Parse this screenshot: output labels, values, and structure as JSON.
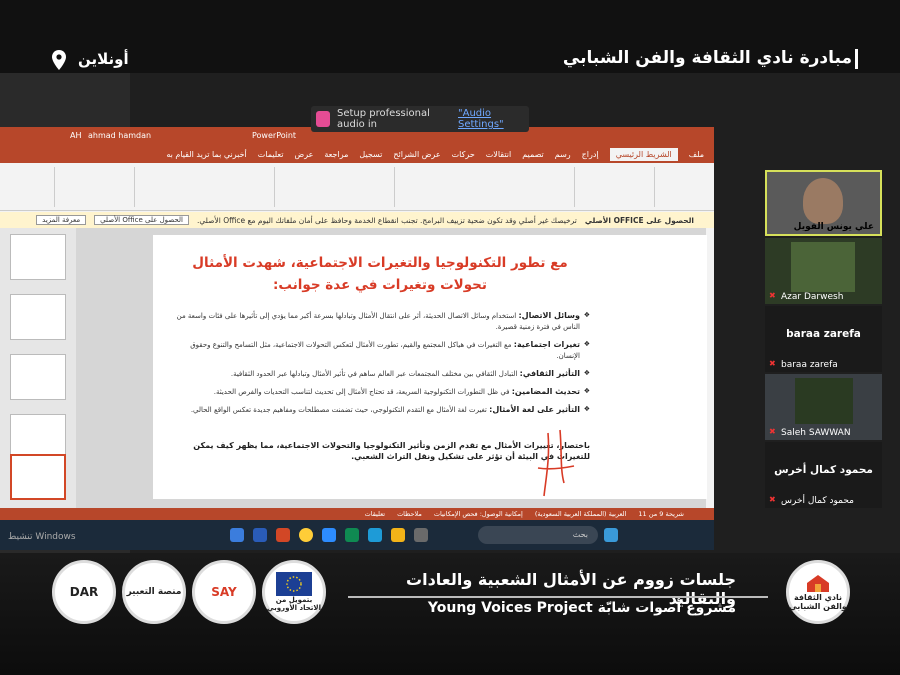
{
  "banner": {
    "title": "مبادرة نادي الثقافة والفن الشبابي",
    "location": "أونلاين"
  },
  "zoom": {
    "audio_prompt": "Setup professional audio in",
    "audio_link": "\"Audio Settings\""
  },
  "powerpoint": {
    "user": "ahmad hamdan",
    "app": "PowerPoint",
    "tabs": [
      "ملف",
      "الشريط الرئيسي",
      "إدراج",
      "رسم",
      "تصميم",
      "انتقالات",
      "حركات",
      "عرض الشرائح",
      "تسجيل",
      "مراجعة",
      "عرض",
      "تعليمات",
      "أخبرني بما تريد القيام به"
    ],
    "message_bar": {
      "label": "الحصول على OFFICE الأصلي",
      "text": "ترخيصك غير أصلي وقد تكون ضحية تزييف البرامج. تجنب انقطاع الخدمة وحافظ على أمان ملفاتك اليوم مع Office الأصلي.",
      "primary_button": "الحصول على Office الأصلي",
      "secondary_button": "معرفة المزيد"
    },
    "status": {
      "slide": "شريحة 9 من 11",
      "language": "العربية (المملكة العربية السعودية)",
      "accessibility": "إمكانية الوصول: فحص الإمكانيات",
      "notes": "ملاحظات",
      "comments": "تعليقات"
    },
    "taskbar_search": "بحث"
  },
  "slide": {
    "title": "مع تطور التكنولوجيا والتغيرات الاجتماعية، شهدت الأمثال تحولات وتغيرات في عدة جوانب:",
    "bullets": [
      {
        "head": "وسائل الاتصال:",
        "text": "استخدام وسائل الاتصال الحديثة، أثر على انتقال الأمثال وتبادلها بسرعة أكبر مما يؤدي إلى تأثيرها على فئات واسعة من الناس في فترة زمنية قصيرة."
      },
      {
        "head": "تغيرات اجتماعية:",
        "text": "مع التغيرات في هياكل المجتمع والقيم، تطورت الأمثال لتعكس التحولات الاجتماعية، مثل التسامح والتنوع وحقوق الإنسان."
      },
      {
        "head": "التأثير الثقافي:",
        "text": "التبادل الثقافي بين مختلف المجتمعات عبر العالم ساهم في تأثير الأمثال وتبادلها عبر الحدود الثقافية."
      },
      {
        "head": "تحديث المضامين:",
        "text": "في ظل التطورات التكنولوجية السريعة، قد تحتاج الأمثال إلى تحديث لتناسب التحديات والفرص الحديثة."
      },
      {
        "head": "التأثير على لغة الأمثال:",
        "text": "تغيرت لغة الأمثال مع التقدم التكنولوجي، حيث تضمنت مصطلحات ومفاهيم جديدة تعكس الواقع الحالي."
      }
    ],
    "summary": "باختصار، تغييرات الأمثال مع تقدم الزمن وتأثير التكنولوجيا والتحولات الاجتماعية، مما يظهر كيف يمكن للتغيرات في البيئة أن تؤثر على تشكيل ونقل التراث الشعبي."
  },
  "participants": [
    {
      "name": "علي يونس الفويل",
      "muted": false,
      "active_speaker": true
    },
    {
      "name": "Azar Darwesh",
      "muted": true
    },
    {
      "name": "baraa zarefa",
      "muted": true,
      "big_label": "baraa zarefa"
    },
    {
      "name": "Saleh SAWWAN",
      "muted": true
    },
    {
      "name": "محمود كمال أخرس",
      "muted": true,
      "big_label": "محمود كمال أخرس"
    }
  ],
  "footer": {
    "sessions_title": "جلسات زووم عن الأمثال الشعبية والعادات والتقاليد",
    "project_title": "مشروع أصوات شابّة Young Voices Project",
    "logos": [
      "DAR",
      "منصة التعبير",
      "SAY",
      "بتمويل من الاتحاد الأوروبي",
      "نادي الثقافة والفن الشبابي"
    ]
  },
  "windows_watermark": "تنشيط Windows",
  "colors": {
    "ppt_accent": "#b7472a",
    "slide_title": "#d83b26",
    "active_speaker_border": "#d6e05a",
    "muted_icon": "#e33333"
  }
}
